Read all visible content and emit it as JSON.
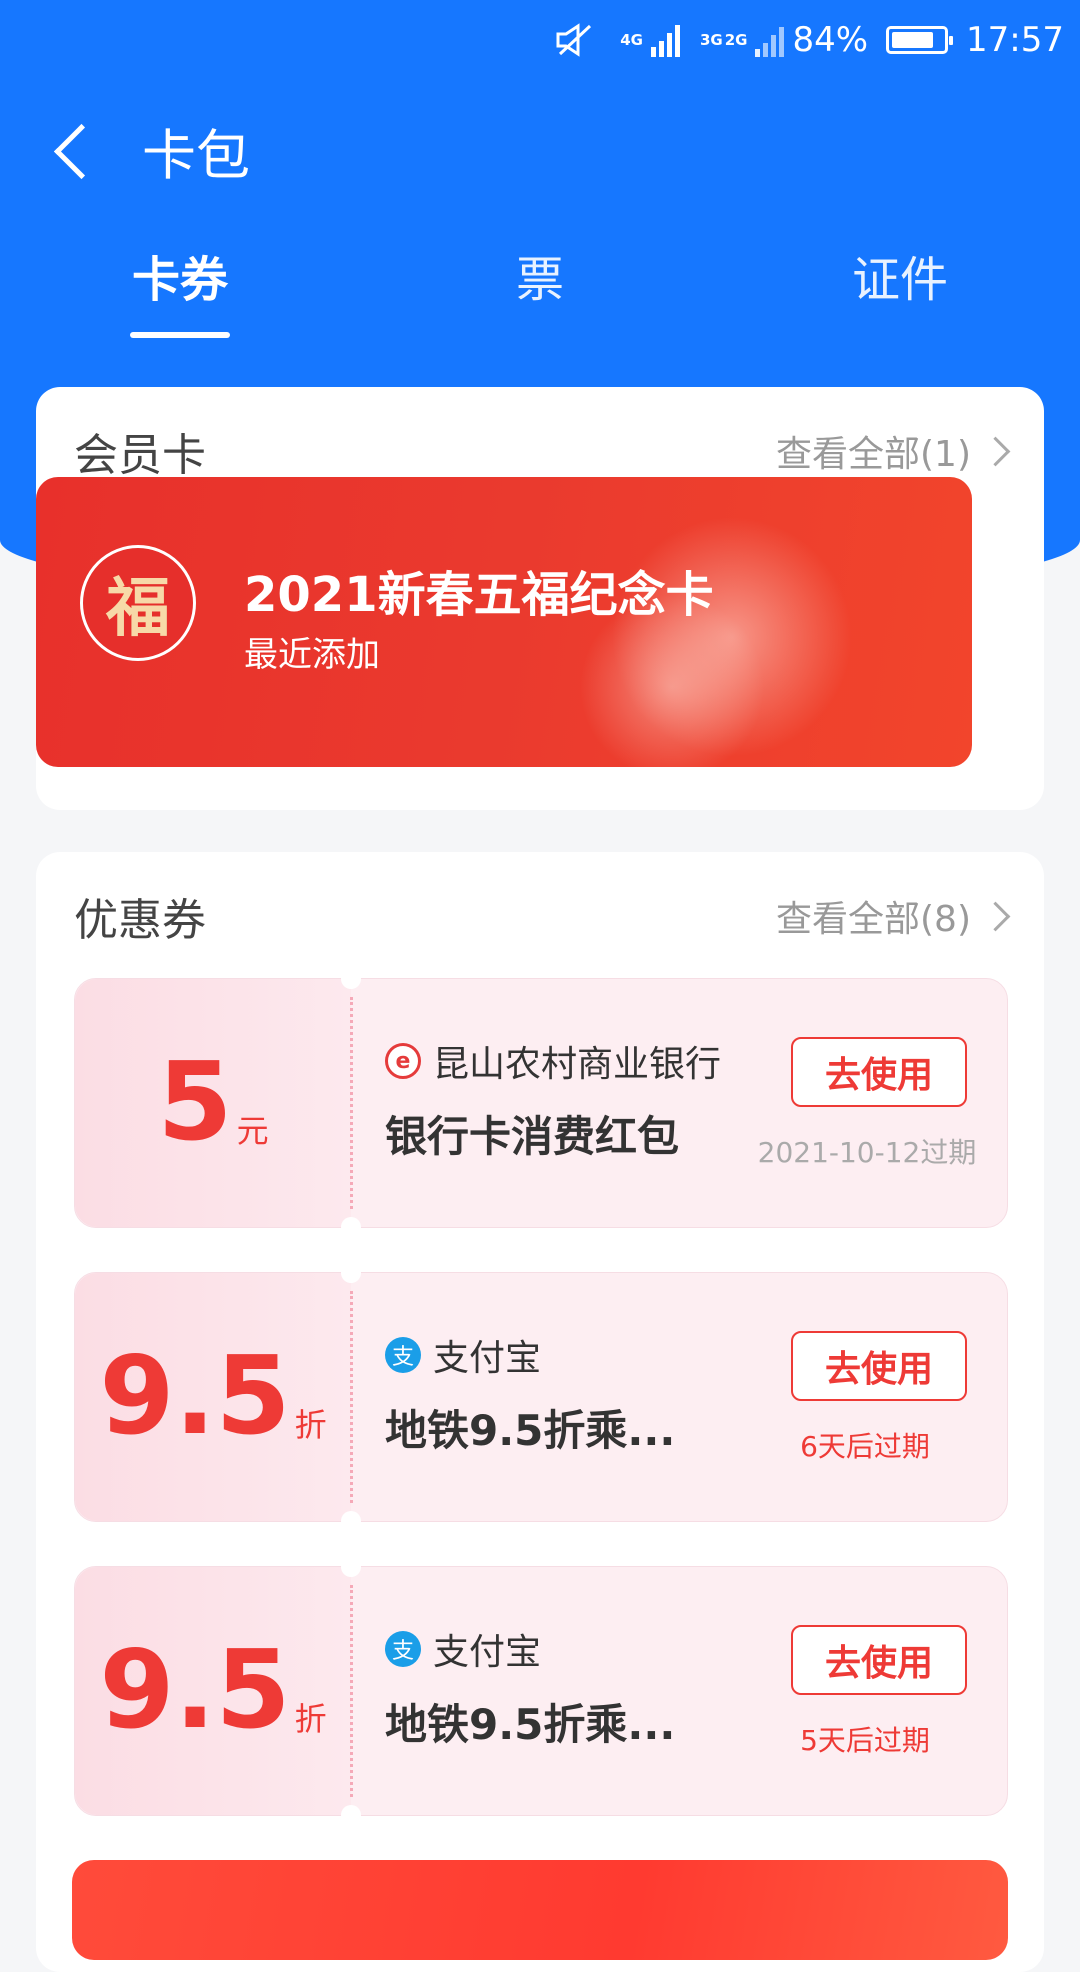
{
  "status_bar": {
    "battery": "84%",
    "time": "17:57",
    "net1": "4G",
    "net2": "3G",
    "net3": "2G",
    "battery_level": 0.84
  },
  "header": {
    "title": "卡包"
  },
  "tabs": [
    {
      "label": "卡券",
      "active": true
    },
    {
      "label": "票",
      "active": false
    },
    {
      "label": "证件",
      "active": false
    }
  ],
  "membership": {
    "title": "会员卡",
    "view_all": "查看全部(1)",
    "card": {
      "logo_char": "福",
      "name": "2021新春五福纪念卡",
      "subtitle": "最近添加"
    }
  },
  "coupons_section": {
    "title": "优惠券",
    "view_all": "查看全部(8)",
    "items": [
      {
        "amount": "5",
        "unit": "元",
        "issuer": "昆山农村商业银行",
        "issuer_icon": "bank-logo-icon",
        "name": "银行卡消费红包",
        "button": "去使用",
        "expiry": "2021-10-12过期"
      },
      {
        "amount": "9.5",
        "unit": "折",
        "issuer": "支付宝",
        "issuer_icon": "alipay-icon",
        "issuer_icon_char": "支",
        "name": "地铁9.5折乘...",
        "button": "去使用",
        "expiry": "6天后过期"
      },
      {
        "amount": "9.5",
        "unit": "折",
        "issuer": "支付宝",
        "issuer_icon": "alipay-icon",
        "issuer_icon_char": "支",
        "name": "地铁9.5折乘...",
        "button": "去使用",
        "expiry": "5天后过期"
      }
    ]
  },
  "colors": {
    "primary_blue": "#1677ff",
    "accent_red": "#ee3a36",
    "card_red": "#e8302b",
    "coupon_bg": "#fdeef2"
  }
}
